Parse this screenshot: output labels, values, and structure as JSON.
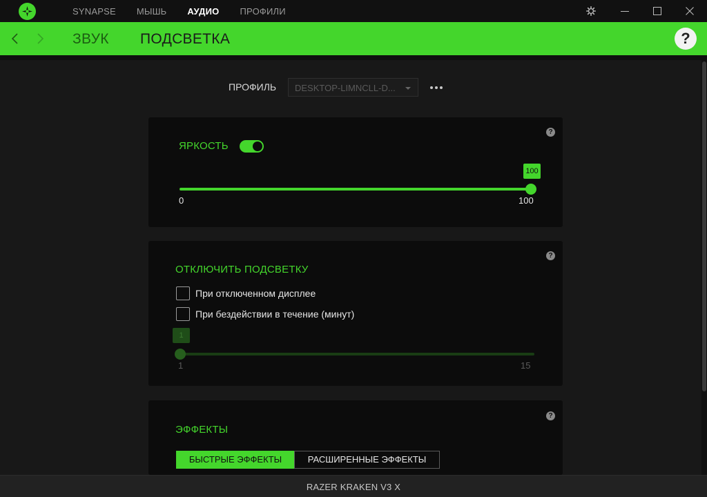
{
  "colors": {
    "accent": "#44d62c",
    "background": "#181818",
    "card": "#0c0c0c"
  },
  "titlebar": {
    "tabs": [
      {
        "label": "SYNAPSE",
        "active": false
      },
      {
        "label": "МЫШЬ",
        "active": false
      },
      {
        "label": "АУДИО",
        "active": true
      },
      {
        "label": "ПРОФИЛИ",
        "active": false
      }
    ],
    "icons": [
      "razer-logo-icon",
      "settings-gear-icon",
      "minimize-icon",
      "maximize-icon",
      "close-icon"
    ]
  },
  "subnav": {
    "tabs": [
      {
        "label": "ЗВУК",
        "active": false
      },
      {
        "label": "ПОДСВЕТКА",
        "active": true
      }
    ],
    "help": "?"
  },
  "profile": {
    "label": "ПРОФИЛЬ",
    "value": "DESKTOP-LIMNCLL-D..."
  },
  "brightness": {
    "title": "ЯРКОСТЬ",
    "enabled": true,
    "value": "100",
    "min": "0",
    "max": "100",
    "help": "?"
  },
  "lighting_off": {
    "title": "ОТКЛЮЧИТЬ ПОДСВЕТКУ",
    "help": "?",
    "options": [
      {
        "label": "При отключенном дисплее",
        "checked": false
      },
      {
        "label": "При бездействии в течение (минут)",
        "checked": false
      }
    ],
    "idle_slider": {
      "value": "1",
      "min": "1",
      "max": "15"
    }
  },
  "effects": {
    "title": "ЭФФЕКТЫ",
    "help": "?",
    "modes": [
      {
        "label": "БЫСТРЫЕ ЭФФЕКТЫ",
        "active": true
      },
      {
        "label": "РАСШИРЕННЫЕ ЭФФЕКТЫ",
        "active": false
      }
    ]
  },
  "footer": {
    "device": "RAZER KRAKEN V3 X"
  }
}
